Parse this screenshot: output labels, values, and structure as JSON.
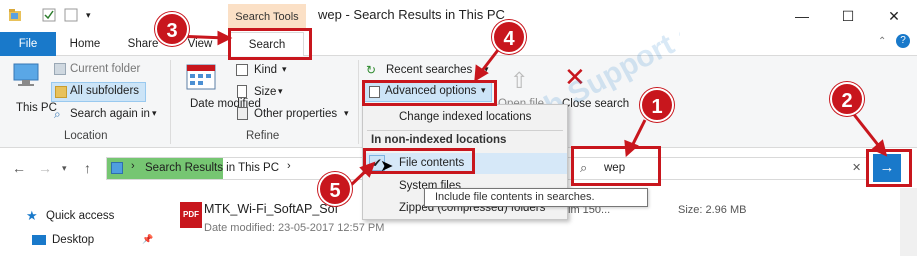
{
  "window": {
    "title": "wep - Search Results in This PC",
    "context_tab_header": "Search Tools",
    "minimize_glyph": "—",
    "maximize_glyph": "☐",
    "close_glyph": "✕"
  },
  "tabs": [
    {
      "label": "File"
    },
    {
      "label": "Home"
    },
    {
      "label": "Share"
    },
    {
      "label": "View"
    },
    {
      "label": "Search"
    }
  ],
  "ribbon": {
    "location": {
      "this_pc": "This PC",
      "current_folder": "Current folder",
      "all_subfolders": "All subfolders",
      "search_again_in": "Search again in",
      "group_label": "Location"
    },
    "refine": {
      "date_modified": "Date modified",
      "kind": "Kind",
      "size": "Size",
      "other_properties": "Other properties",
      "group_label": "Refine"
    },
    "options": {
      "recent_searches": "Recent searches",
      "advanced_options": "Advanced options",
      "open_file_location": "Open file",
      "close_search": "Close search"
    }
  },
  "menu": {
    "change_indexed": "Change indexed locations",
    "section_header": "In non-indexed locations",
    "items": [
      {
        "label": "File contents",
        "checked": true
      },
      {
        "label": "System files",
        "checked": false
      },
      {
        "label": "Zipped (compressed) folders",
        "checked": false
      }
    ],
    "tooltip": "Include file contents in searches."
  },
  "address": {
    "path": "Search Results in This PC",
    "separator": "›",
    "search_value": "wep"
  },
  "navpane": {
    "quick_access": "Quick access",
    "desktop": "Desktop"
  },
  "results": [
    {
      "name": "MTK_Wi-Fi_SoftAP_Sof",
      "date": "Date modified: 23-05-2017 12:57 PM",
      "size": "Size: 2.96 MB",
      "extra": "im 150..."
    }
  ],
  "annotations": [
    "1",
    "2",
    "3",
    "4",
    "5"
  ],
  "watermark": "Tech Support all Technical Help Center",
  "colors": {
    "accent": "#1979ca",
    "annotation_red": "#c8161d",
    "selection": "#cce4f7",
    "address_highlight": "#76c672"
  }
}
